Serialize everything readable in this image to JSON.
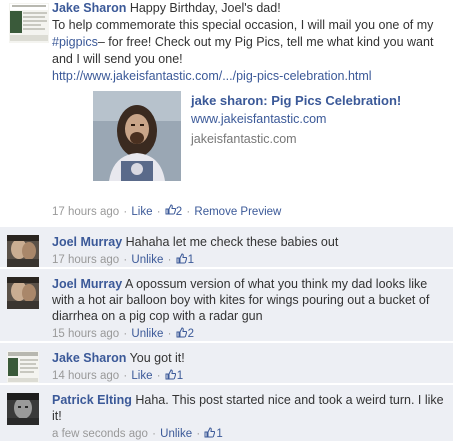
{
  "post": {
    "author": "Jake Sharon",
    "text_line1": "Happy Birthday, Joel's dad!",
    "text_line2": "To help commemorate this special occasion, I will mail you one of my ",
    "hashtag": "#pigpics",
    "text_line3": "– for free! Check out my Pig Pics, tell me what kind you want and I will send you one!",
    "url": "http://www.jakeisfantastic.com/.../pig-pics-celebration.html",
    "attachment": {
      "title": "jake sharon: Pig Pics Celebration!",
      "domain": "www.jakeisfantastic.com",
      "caption": "jakeisfantastic.com"
    },
    "time": "17 hours ago",
    "like_label": "Like",
    "like_count": "2",
    "remove_preview_label": "Remove Preview"
  },
  "comments": [
    {
      "author": "Joel Murray",
      "text": "Hahaha let me check these babies out",
      "time": "17 hours ago",
      "action_label": "Unlike",
      "like_count": "1"
    },
    {
      "author": "Joel Murray",
      "text": "A opossum version of what you think my dad looks like with a hot air balloon boy with kites for wings pouring out a bucket of diarrhea on a pig cop with a radar gun",
      "time": "15 hours ago",
      "action_label": "Unlike",
      "like_count": "2"
    },
    {
      "author": "Jake Sharon",
      "text": "You got it!",
      "time": "14 hours ago",
      "action_label": "Like",
      "like_count": "1"
    },
    {
      "author": "Patrick Elting",
      "text": "Haha. This post started nice and took a weird turn. I like it!",
      "time": "a few seconds ago",
      "action_label": "Unlike",
      "like_count": "1"
    }
  ],
  "separator": "·",
  "colors": {
    "link": "#3b5998",
    "comment_bg": "#edeff4",
    "meta_text": "#999999"
  },
  "icons": {
    "like": "thumbs-up-icon"
  }
}
